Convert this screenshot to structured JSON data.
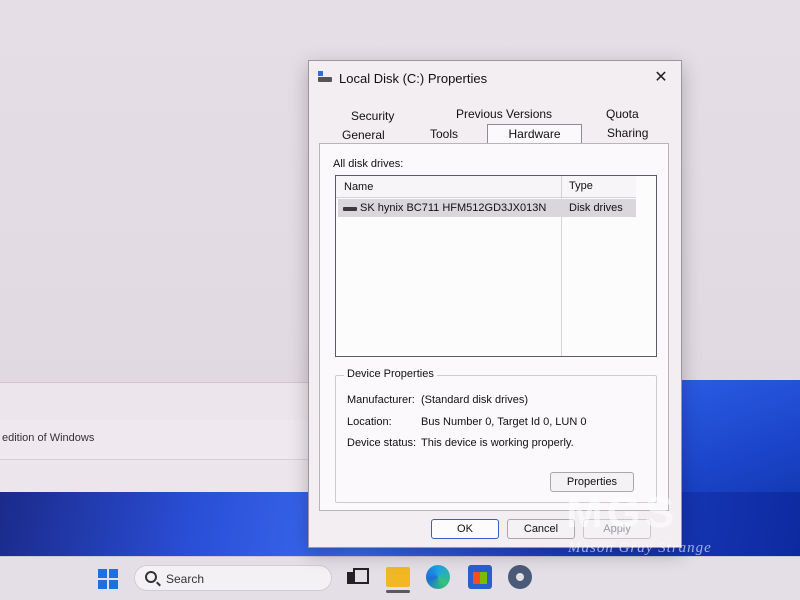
{
  "background": {
    "edition_text": "edition of Windows"
  },
  "taskbar": {
    "search_label": "Search"
  },
  "dialog": {
    "title": "Local Disk (C:) Properties",
    "close_glyph": "✕",
    "tabs": [
      {
        "label": "Security",
        "row": 1
      },
      {
        "label": "Previous Versions",
        "row": 1
      },
      {
        "label": "Quota",
        "row": 1
      },
      {
        "label": "General",
        "row": 2
      },
      {
        "label": "Tools",
        "row": 2
      },
      {
        "label": "Hardware",
        "row": 2,
        "active": true
      },
      {
        "label": "Sharing",
        "row": 2
      }
    ],
    "hardware": {
      "all_disk_drives_label": "All disk drives:",
      "columns": {
        "name": "Name",
        "type": "Type"
      },
      "rows": [
        {
          "name": "SK hynix BC711 HFM512GD3JX013N",
          "type": "Disk drives",
          "selected": true
        }
      ],
      "device_properties": {
        "title": "Device Properties",
        "manufacturer_label": "Manufacturer:",
        "manufacturer_value": "(Standard disk drives)",
        "location_label": "Location:",
        "location_value": "Bus Number 0, Target Id 0, LUN 0",
        "status_label": "Device status:",
        "status_value": "This device is working properly.",
        "properties_button": "Properties"
      }
    },
    "buttons": {
      "ok": "OK",
      "cancel": "Cancel",
      "apply": "Apply"
    }
  },
  "watermark": {
    "logo": "MGS",
    "text": "Mason Gray Strange"
  },
  "colors": {
    "accent": "#2f63c8",
    "wallpaper": "#2a4fd8"
  }
}
